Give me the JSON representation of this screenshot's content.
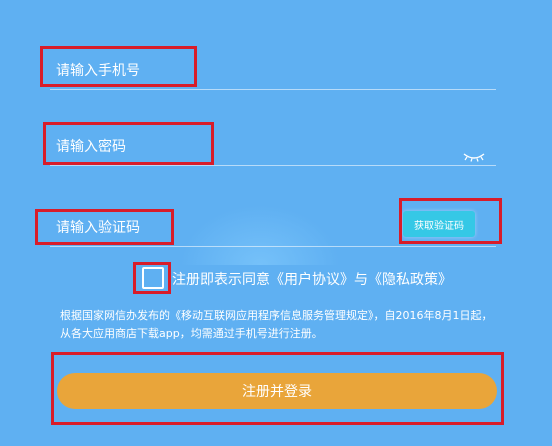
{
  "form": {
    "phone_placeholder": "请输入手机号",
    "password_placeholder": "请输入密码",
    "code_placeholder": "请输入验证码",
    "get_code_label": "获取验证码",
    "agree_prefix": "注册即表示同意",
    "user_agreement": "《用户协议》",
    "agree_and": "与",
    "privacy_policy": "《隐私政策》",
    "notice": "根据国家网信办发布的《移动互联网应用程序信息服务管理规定》，自2016年8月1日起，从各大应用商店下载app，均需通过手机号进行注册。",
    "submit_label": "注册并登录"
  },
  "icons": {
    "password_visibility": "eye-closed-icon"
  },
  "colors": {
    "background": "#5fb0f2",
    "annotation_box": "#d81c2a",
    "code_button": "#35c8e6",
    "submit_button": "#e9a53a"
  }
}
